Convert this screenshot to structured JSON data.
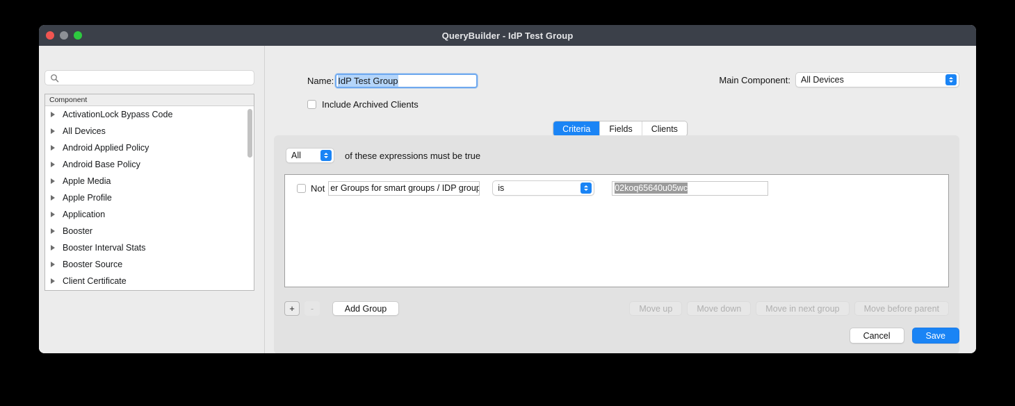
{
  "window": {
    "title": "QueryBuilder - IdP Test Group",
    "traffic_lights": [
      "close",
      "minimize",
      "zoom"
    ]
  },
  "sidebar": {
    "search": {
      "value": "",
      "placeholder": ""
    },
    "list_header": "Component",
    "items": [
      {
        "label": "ActivationLock Bypass Code"
      },
      {
        "label": "All Devices"
      },
      {
        "label": "Android Applied Policy"
      },
      {
        "label": "Android Base Policy"
      },
      {
        "label": "Apple Media"
      },
      {
        "label": "Apple Profile"
      },
      {
        "label": "Application"
      },
      {
        "label": "Booster"
      },
      {
        "label": "Booster Interval Stats"
      },
      {
        "label": "Booster Source"
      },
      {
        "label": "Client Certificate"
      }
    ]
  },
  "form": {
    "name_label": "Name:",
    "name_value": "IdP Test Group",
    "include_archived_label": "Include Archived Clients",
    "include_archived_checked": false,
    "main_component_label": "Main Component:",
    "main_component_value": "All Devices"
  },
  "tabs": [
    {
      "label": "Criteria",
      "active": true
    },
    {
      "label": "Fields",
      "active": false
    },
    {
      "label": "Clients",
      "active": false
    }
  ],
  "criteria": {
    "match_value": "All",
    "match_text": "of these expressions must be true",
    "rows": [
      {
        "not_label": "Not",
        "not_checked": false,
        "field_value": "er Groups for smart groups / IDP group id",
        "operator_value": "is",
        "value": "02koq65640u05wc"
      }
    ],
    "buttons": {
      "add": "+",
      "remove": "-",
      "add_group": "Add Group",
      "move_up": "Move up",
      "move_down": "Move down",
      "move_in_next_group": "Move in next group",
      "move_before_parent": "Move before parent"
    }
  },
  "footer": {
    "cancel": "Cancel",
    "save": "Save"
  },
  "colors": {
    "accent": "#1a84f5",
    "titlebar": "#3b4049",
    "selection": "#b4d5fa",
    "inactive_selection": "#9b9b9b"
  }
}
